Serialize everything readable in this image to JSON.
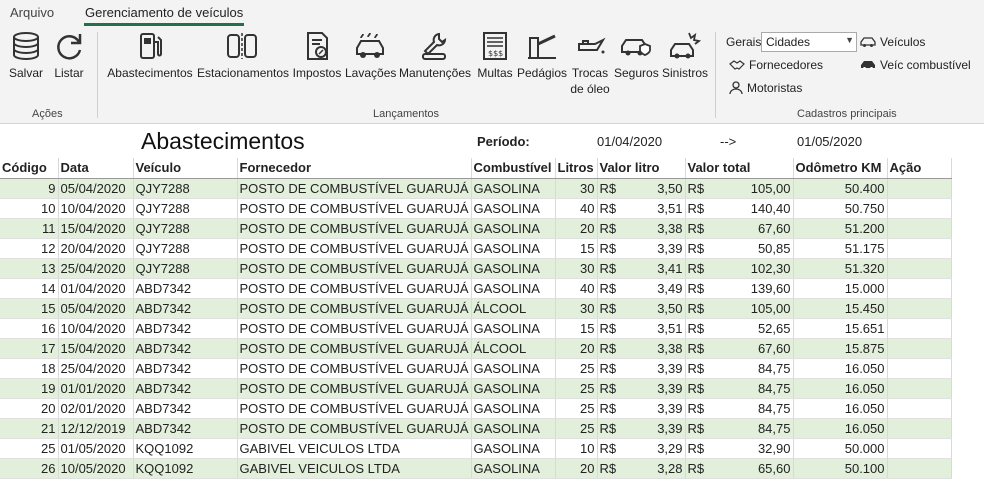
{
  "tabs": [
    "Arquivo",
    "Gerenciamento de veículos"
  ],
  "ribbon": {
    "acoes": {
      "label": "Ações",
      "buttons": [
        "Salvar",
        "Listar"
      ]
    },
    "lancamentos": {
      "label": "Lançamentos",
      "buttons": [
        "Abastecimentos",
        "Estacionamentos",
        "Impostos",
        "Lavações",
        "Manutenções",
        "Multas",
        "Pedágios",
        "Trocas",
        "de óleo",
        "Seguros",
        "Sinistros"
      ]
    },
    "cadastros": {
      "label": "Cadastros principais",
      "gerais_label": "Gerais",
      "gerais_value": "Cidades",
      "items": [
        "Veículos",
        "Fornecedores",
        "Veíc combustível",
        "Motoristas"
      ]
    }
  },
  "sheet": {
    "title": "Abastecimentos",
    "periodo_label": "Período:",
    "periodo_inicio": "01/04/2020",
    "periodo_arrow": "-->",
    "periodo_fim": "01/05/2020",
    "headers": [
      "Código",
      "Data",
      "Veículo",
      "Fornecedor",
      "Combustível",
      "Litros",
      "Valor litro",
      "Valor total",
      "Odômetro KM",
      "Ação"
    ],
    "currency": "R$",
    "rows": [
      [
        "9",
        "05/04/2020",
        "QJY7288",
        "POSTO DE COMBUSTÍVEL GUARUJÁ",
        "GASOLINA",
        "30",
        "3,50",
        "105,00",
        "50.400"
      ],
      [
        "10",
        "10/04/2020",
        "QJY7288",
        "POSTO DE COMBUSTÍVEL GUARUJÁ",
        "GASOLINA",
        "40",
        "3,51",
        "140,40",
        "50.750"
      ],
      [
        "11",
        "15/04/2020",
        "QJY7288",
        "POSTO DE COMBUSTÍVEL GUARUJÁ",
        "GASOLINA",
        "20",
        "3,38",
        "67,60",
        "51.200"
      ],
      [
        "12",
        "20/04/2020",
        "QJY7288",
        "POSTO DE COMBUSTÍVEL GUARUJÁ",
        "GASOLINA",
        "15",
        "3,39",
        "50,85",
        "51.175"
      ],
      [
        "13",
        "25/04/2020",
        "QJY7288",
        "POSTO DE COMBUSTÍVEL GUARUJÁ",
        "GASOLINA",
        "30",
        "3,41",
        "102,30",
        "51.320"
      ],
      [
        "14",
        "01/04/2020",
        "ABD7342",
        "POSTO DE COMBUSTÍVEL GUARUJÁ",
        "GASOLINA",
        "40",
        "3,49",
        "139,60",
        "15.000"
      ],
      [
        "15",
        "05/04/2020",
        "ABD7342",
        "POSTO DE COMBUSTÍVEL GUARUJÁ",
        "ÁLCOOL",
        "30",
        "3,50",
        "105,00",
        "15.450"
      ],
      [
        "16",
        "10/04/2020",
        "ABD7342",
        "POSTO DE COMBUSTÍVEL GUARUJÁ",
        "GASOLINA",
        "15",
        "3,51",
        "52,65",
        "15.651"
      ],
      [
        "17",
        "15/04/2020",
        "ABD7342",
        "POSTO DE COMBUSTÍVEL GUARUJÁ",
        "ÁLCOOL",
        "20",
        "3,38",
        "67,60",
        "15.875"
      ],
      [
        "18",
        "25/04/2020",
        "ABD7342",
        "POSTO DE COMBUSTÍVEL GUARUJÁ",
        "GASOLINA",
        "25",
        "3,39",
        "84,75",
        "16.050"
      ],
      [
        "19",
        "01/01/2020",
        "ABD7342",
        "POSTO DE COMBUSTÍVEL GUARUJÁ",
        "GASOLINA",
        "25",
        "3,39",
        "84,75",
        "16.050"
      ],
      [
        "20",
        "02/01/2020",
        "ABD7342",
        "POSTO DE COMBUSTÍVEL GUARUJÁ",
        "GASOLINA",
        "25",
        "3,39",
        "84,75",
        "16.050"
      ],
      [
        "21",
        "12/12/2019",
        "ABD7342",
        "POSTO DE COMBUSTÍVEL GUARUJÁ",
        "GASOLINA",
        "25",
        "3,39",
        "84,75",
        "16.050"
      ],
      [
        "25",
        "01/05/2020",
        "KQQ1092",
        "GABIVEL VEICULOS LTDA",
        "GASOLINA",
        "10",
        "3,29",
        "32,90",
        "50.000"
      ],
      [
        "26",
        "10/05/2020",
        "KQQ1092",
        "GABIVEL VEICULOS LTDA",
        "GASOLINA",
        "20",
        "3,28",
        "65,60",
        "50.100"
      ]
    ]
  },
  "colors": {
    "accent": "#217346",
    "row_alt": "#e2efda",
    "ribbon_bg": "#f3f3f3"
  }
}
